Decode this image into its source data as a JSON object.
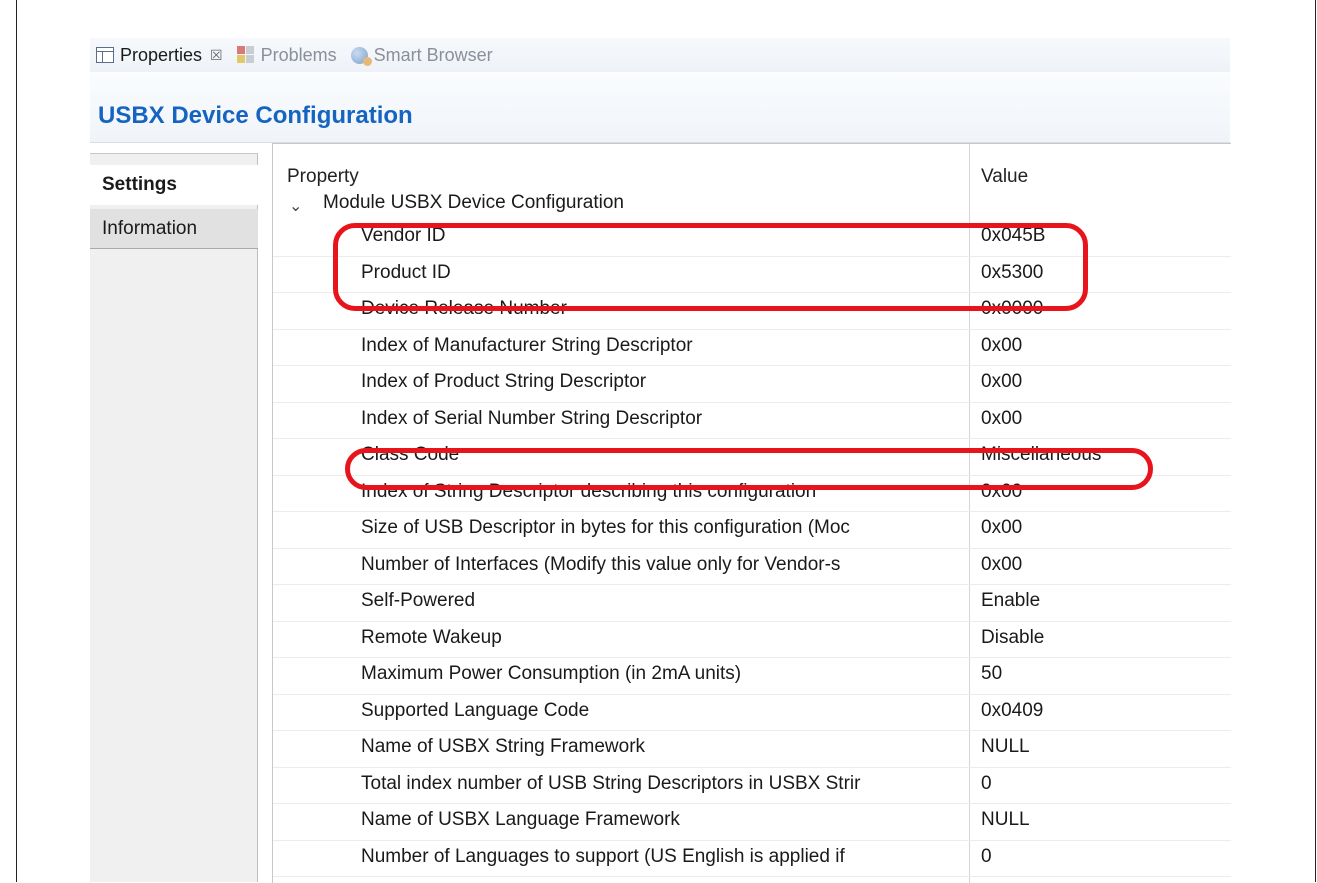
{
  "tabs": [
    {
      "label": "Properties",
      "icon": "properties-icon",
      "active": true
    },
    {
      "label": "Problems",
      "icon": "problems-icon",
      "active": false
    },
    {
      "label": "Smart Browser",
      "icon": "smart-browser-icon",
      "active": false
    }
  ],
  "tab_close_glyph": "☒",
  "section_title": "USBX Device Configuration",
  "side_tabs": [
    "Settings",
    "Information"
  ],
  "table": {
    "col_property": "Property",
    "col_value": "Value",
    "group_label": "Module USBX Device Configuration",
    "group_chevron": "⌄",
    "rows": [
      {
        "property": "Vendor ID",
        "value": "0x045B"
      },
      {
        "property": "Product ID",
        "value": "0x5300"
      },
      {
        "property": "Device Release Number",
        "value": "0x0000"
      },
      {
        "property": "Index of Manufacturer String Descriptor",
        "value": "0x00"
      },
      {
        "property": "Index of Product String Descriptor",
        "value": "0x00"
      },
      {
        "property": "Index of Serial Number String Descriptor",
        "value": "0x00"
      },
      {
        "property": "Class Code",
        "value": "Miscellaneous"
      },
      {
        "property": "Index of String Descriptor describing this configuration",
        "value": "0x00"
      },
      {
        "property": "Size of USB Descriptor in bytes for this configuration (Moc",
        "value": "0x00"
      },
      {
        "property": "Number of Interfaces (Modify this value only for Vendor-s",
        "value": "0x00"
      },
      {
        "property": "Self-Powered",
        "value": "Enable"
      },
      {
        "property": "Remote Wakeup",
        "value": "Disable"
      },
      {
        "property": "Maximum Power Consumption (in 2mA units)",
        "value": "50"
      },
      {
        "property": "Supported Language Code",
        "value": "0x0409"
      },
      {
        "property": "Name of USBX String Framework",
        "value": "NULL"
      },
      {
        "property": "Total index number of USB String Descriptors in USBX Strir",
        "value": "0"
      },
      {
        "property": "Name of USBX Language Framework",
        "value": "NULL"
      },
      {
        "property": "Number of Languages to support (US English is applied if",
        "value": "0"
      }
    ]
  },
  "colors": {
    "title": "#1565c0",
    "annotation": "#e8141c"
  }
}
